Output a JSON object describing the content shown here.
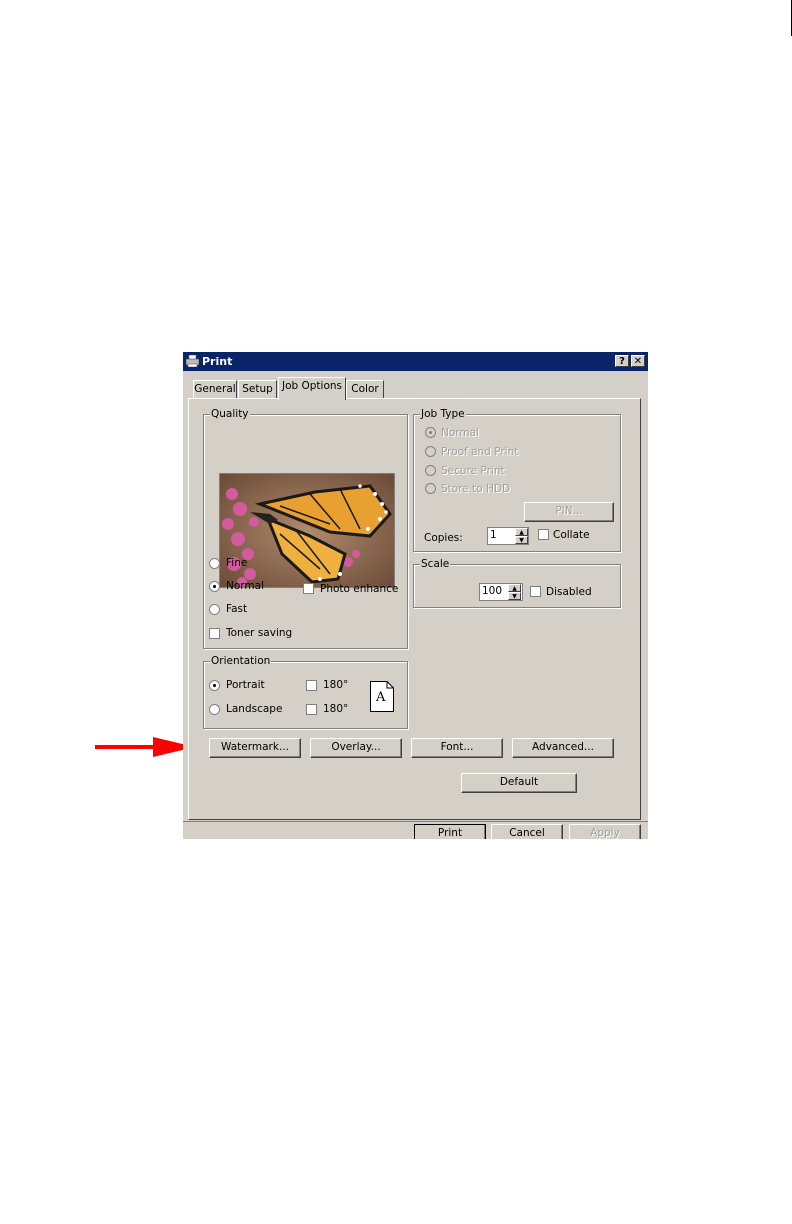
{
  "dialog": {
    "title": "Print",
    "help_btn": "?",
    "close_btn": "✕",
    "tabs": [
      "General",
      "Setup",
      "Job Options",
      "Color"
    ],
    "active_tab": "Job Options"
  },
  "quality": {
    "label": "Quality",
    "options": [
      "Fine",
      "Normal",
      "Fast"
    ],
    "selected": "Normal",
    "photo_enhance": "Photo enhance",
    "toner_saving": "Toner saving"
  },
  "job_type": {
    "label": "Job Type",
    "options": [
      "Normal",
      "Proof and Print",
      "Secure Print",
      "Store to HDD"
    ],
    "selected": "Normal",
    "pin_button": "PIN...",
    "copies_label": "Copies:",
    "copies_value": "1",
    "collate": "Collate"
  },
  "scale": {
    "label": "Scale",
    "value": "100",
    "disabled_label": "Disabled"
  },
  "orientation": {
    "label": "Orientation",
    "portrait": "Portrait",
    "landscape": "Landscape",
    "selected": "Portrait",
    "rotate_label": "180°",
    "page_letter": "A"
  },
  "buttons": {
    "watermark": "Watermark...",
    "overlay": "Overlay...",
    "font": "Font...",
    "advanced": "Advanced...",
    "default": "Default"
  },
  "footer": {
    "print": "Print",
    "cancel": "Cancel",
    "apply": "Apply"
  },
  "colors": {
    "face": "#d4d0c8",
    "titlebar": "#0a246a",
    "arrow": "#ff0000"
  }
}
